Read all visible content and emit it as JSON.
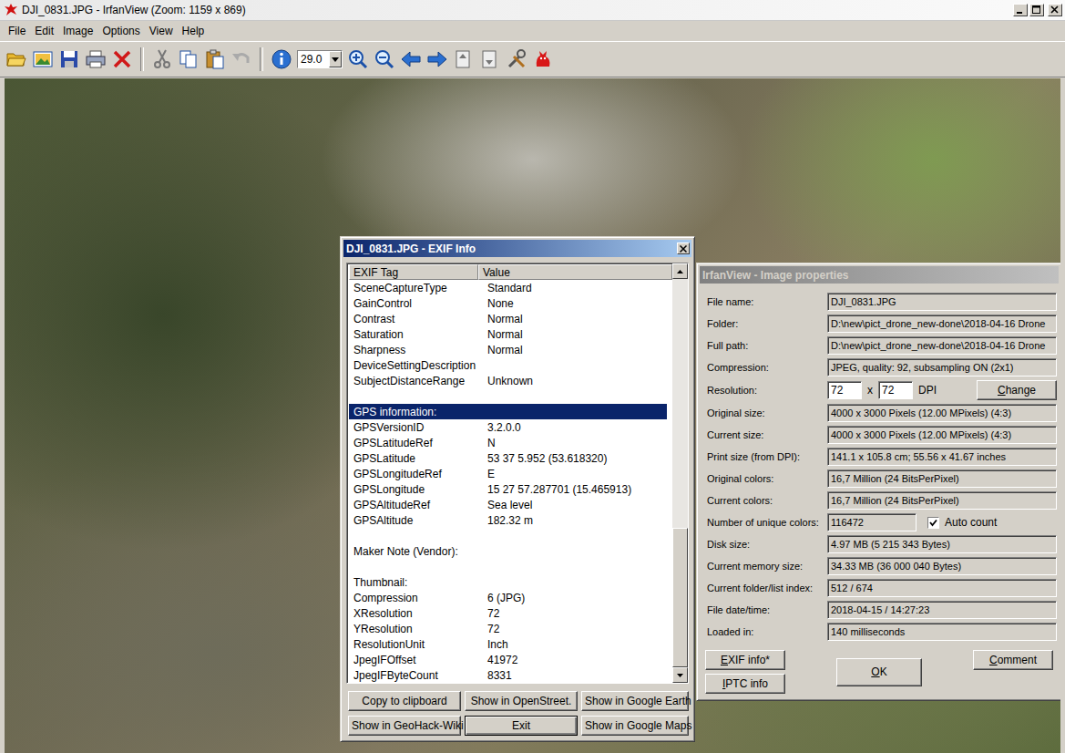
{
  "window": {
    "title": "DJI_0831.JPG - IrfanView (Zoom: 1159 x 869)",
    "active": false
  },
  "menu": [
    {
      "label": "File"
    },
    {
      "label": "Edit"
    },
    {
      "label": "Image"
    },
    {
      "label": "Options"
    },
    {
      "label": "View"
    },
    {
      "label": "Help"
    }
  ],
  "toolbar": {
    "zoom": "29.0"
  },
  "exif": {
    "title": "DJI_0831.JPG - EXIF Info",
    "active": true,
    "columns": [
      "EXIF Tag",
      "Value"
    ],
    "rows": [
      {
        "tag": "SceneCaptureType",
        "value": "Standard",
        "selected": false
      },
      {
        "tag": "GainControl",
        "value": "None",
        "selected": false
      },
      {
        "tag": "Contrast",
        "value": "Normal",
        "selected": false
      },
      {
        "tag": "Saturation",
        "value": "Normal",
        "selected": false
      },
      {
        "tag": "Sharpness",
        "value": "Normal",
        "selected": false
      },
      {
        "tag": "DeviceSettingDescription",
        "value": "",
        "selected": false
      },
      {
        "tag": "SubjectDistanceRange",
        "value": "Unknown",
        "selected": false
      },
      {
        "tag": "",
        "value": "",
        "selected": false
      },
      {
        "tag": "GPS information:",
        "value": "",
        "selected": true
      },
      {
        "tag": "GPSVersionID",
        "value": "3.2.0.0",
        "selected": false
      },
      {
        "tag": "GPSLatitudeRef",
        "value": "N",
        "selected": false
      },
      {
        "tag": "GPSLatitude",
        "value": "53  37  5.952 (53.618320)",
        "selected": false
      },
      {
        "tag": "GPSLongitudeRef",
        "value": "E",
        "selected": false
      },
      {
        "tag": "GPSLongitude",
        "value": "15  27  57.287701 (15.465913)",
        "selected": false
      },
      {
        "tag": "GPSAltitudeRef",
        "value": "Sea level",
        "selected": false
      },
      {
        "tag": "GPSAltitude",
        "value": "182.32 m",
        "selected": false
      },
      {
        "tag": "",
        "value": "",
        "selected": false
      },
      {
        "tag": "Maker Note (Vendor):",
        "value": "",
        "selected": false
      },
      {
        "tag": "",
        "value": "",
        "selected": false
      },
      {
        "tag": "Thumbnail:",
        "value": "",
        "selected": false
      },
      {
        "tag": "Compression",
        "value": "6 (JPG)",
        "selected": false
      },
      {
        "tag": "XResolution",
        "value": "72",
        "selected": false
      },
      {
        "tag": "YResolution",
        "value": "72",
        "selected": false
      },
      {
        "tag": "ResolutionUnit",
        "value": "Inch",
        "selected": false
      },
      {
        "tag": "JpegIFOffset",
        "value": "41972",
        "selected": false
      },
      {
        "tag": "JpegIFByteCount",
        "value": "8331",
        "selected": false
      }
    ],
    "scrollbar": {
      "level": 1
    },
    "buttons": [
      {
        "label": "Copy to clipboard",
        "default": false
      },
      {
        "label": "Show in OpenStreet.",
        "default": false
      },
      {
        "label": "Show in Google Earth",
        "default": false
      },
      {
        "label": "Show in GeoHack-Wiki",
        "default": false
      },
      {
        "label": "Exit",
        "default": true
      },
      {
        "label": "Show in Google Maps",
        "default": false
      }
    ]
  },
  "properties": {
    "title": "IrfanView - Image properties",
    "active": false,
    "fields": [
      {
        "kind": "field",
        "label": "File name:",
        "value": "DJI_0831.JPG"
      },
      {
        "kind": "field",
        "label": "Folder:",
        "value": "D:\\new\\pict_drone_new-done\\2018-04-16 Drone"
      },
      {
        "kind": "field",
        "label": "Full path:",
        "value": "D:\\new\\pict_drone_new-done\\2018-04-16 Drone"
      },
      {
        "kind": "field",
        "label": "Compression:",
        "value": "JPEG, quality: 92, subsampling ON (2x1)"
      },
      {
        "kind": "resolution",
        "label": "Resolution:",
        "x": "72",
        "separator": "x",
        "y": "72",
        "unit": "DPI",
        "button": {
          "label": "Change",
          "mnemonic": true
        }
      },
      {
        "kind": "field",
        "label": "Original size:",
        "value": "4000 x 3000  Pixels (12.00 MPixels) (4:3)"
      },
      {
        "kind": "field",
        "label": "Current size:",
        "value": "4000 x 3000  Pixels (12.00 MPixels) (4:3)"
      },
      {
        "kind": "field",
        "label": "Print size (from DPI):",
        "value": "141.1 x 105.8 cm; 55.56 x 41.67 inches"
      },
      {
        "kind": "field",
        "label": "Original colors:",
        "value": "16,7 Million   (24 BitsPerPixel)"
      },
      {
        "kind": "field",
        "label": "Current colors:",
        "value": "16,7 Million   (24 BitsPerPixel)"
      },
      {
        "kind": "count",
        "label": "Number of unique colors:",
        "value": "116472",
        "checkbox": {
          "label": "Auto count",
          "checked": true
        }
      },
      {
        "kind": "field",
        "label": "Disk size:",
        "value": "4.97 MB (5 215 343 Bytes)"
      },
      {
        "kind": "field",
        "label": "Current memory size:",
        "value": "34.33 MB (36 000 040 Bytes)"
      },
      {
        "kind": "field",
        "label": "Current folder/list index:",
        "value": "512  /  674"
      },
      {
        "kind": "field",
        "label": "File date/time:",
        "value": "2018-04-15 / 14:27:23"
      },
      {
        "kind": "field",
        "label": "Loaded in:",
        "value": "140 milliseconds"
      }
    ],
    "buttons": [
      {
        "label": "EXIF info*",
        "mnemonic": true
      },
      {
        "label": "IPTC info",
        "mnemonic": true
      },
      {
        "label": "OK",
        "mnemonic": true
      },
      {
        "label": "Comment",
        "mnemonic": true
      }
    ]
  }
}
